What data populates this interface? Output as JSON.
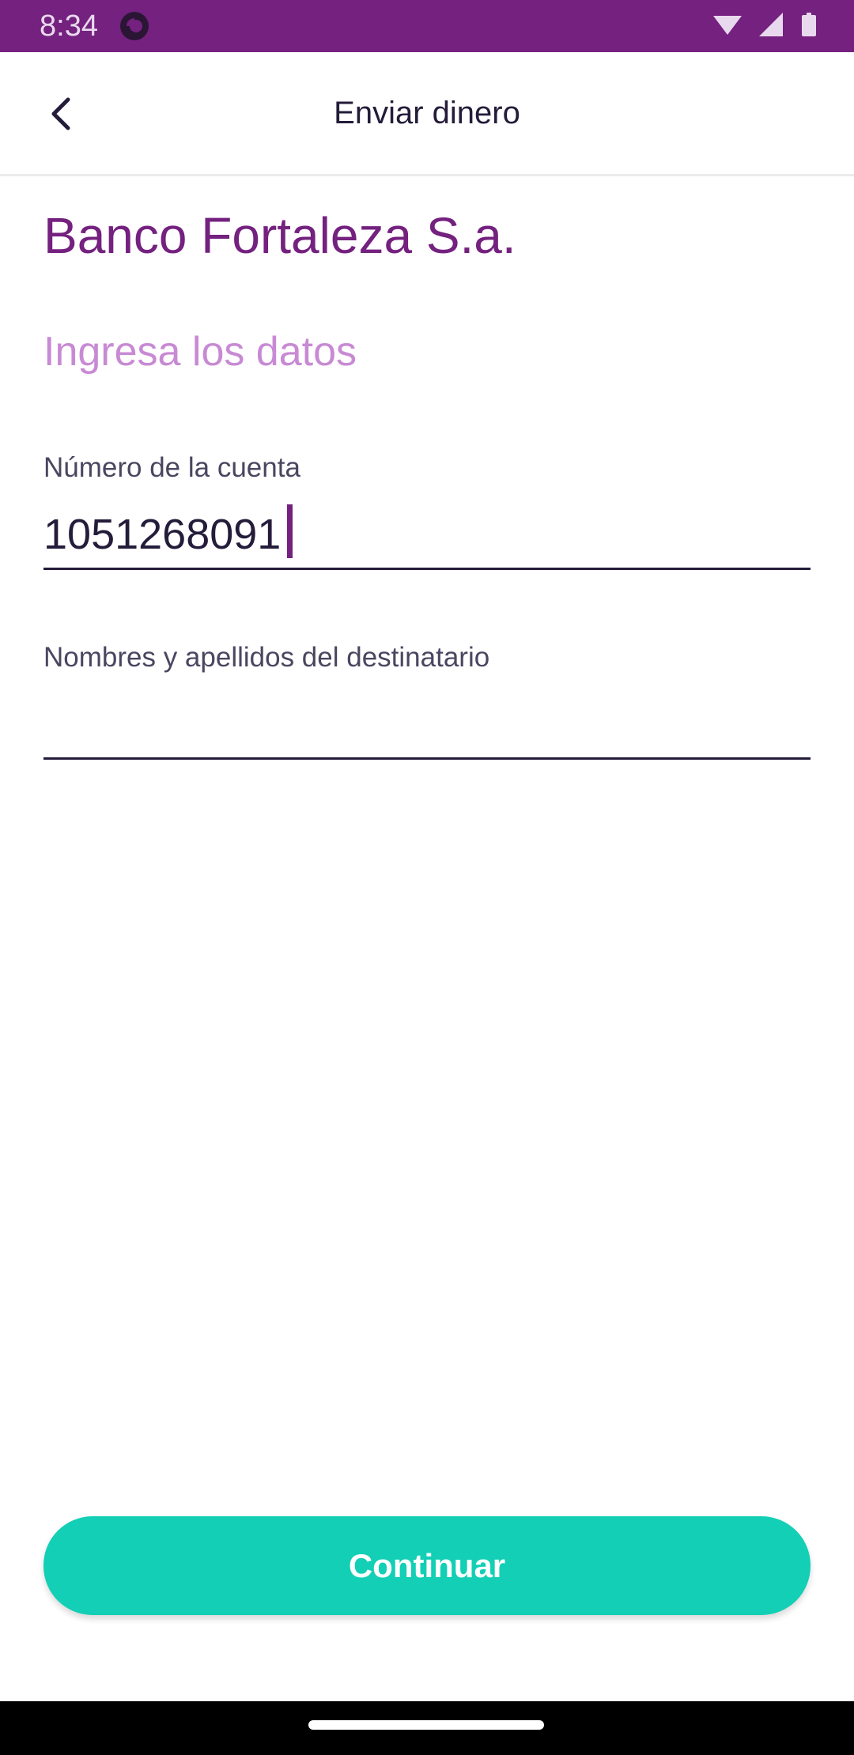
{
  "status_bar": {
    "time": "8:34",
    "background_color": "#74217f",
    "icons": [
      "app-icon",
      "wifi-icon",
      "signal-icon",
      "battery-icon"
    ]
  },
  "app_bar": {
    "title": "Enviar dinero",
    "back_icon": "chevron-left-icon"
  },
  "form": {
    "bank_name": "Banco Fortaleza S.a.",
    "section_title": "Ingresa los datos",
    "account_field": {
      "label": "Número de la cuenta",
      "value": "1051268091"
    },
    "name_field": {
      "label": "Nombres y apellidos del destinatario",
      "value": ""
    }
  },
  "actions": {
    "continue_label": "Continuar"
  },
  "colors": {
    "brand": "#74217f",
    "accent_light": "#c88ad4",
    "button": "#12cfb5"
  }
}
